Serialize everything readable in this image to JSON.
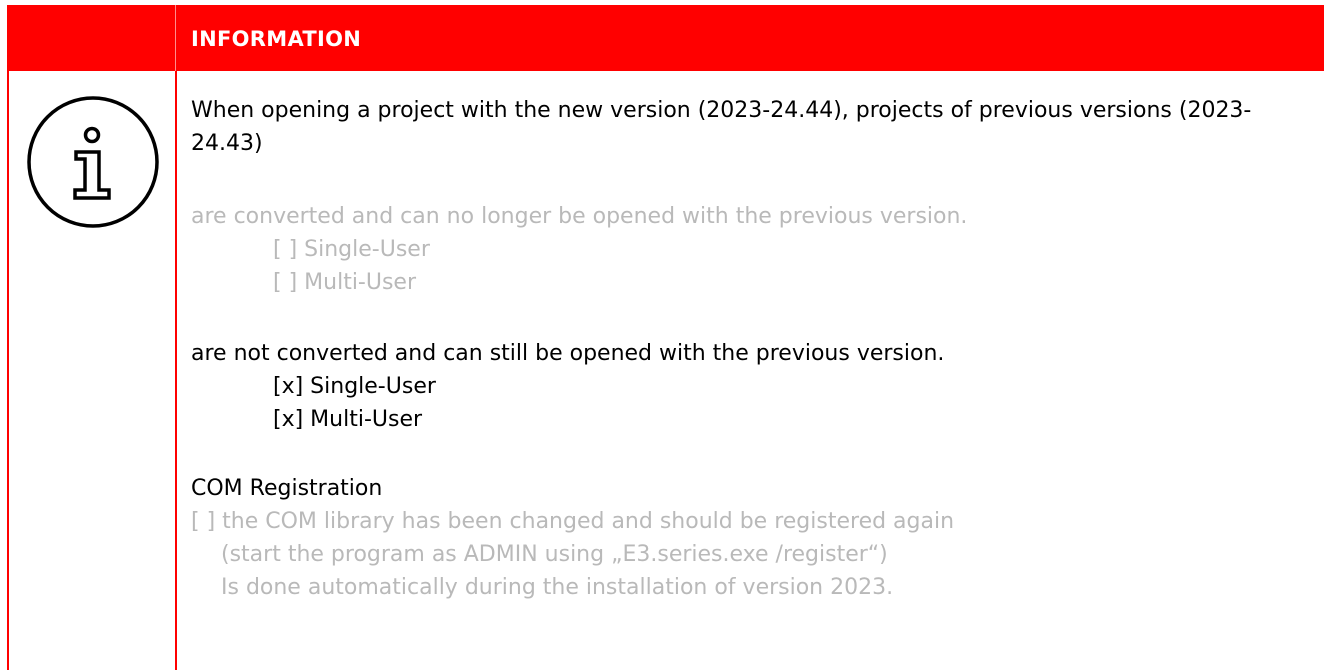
{
  "header": {
    "title": "INFORMATION"
  },
  "icon": {
    "name": "info-icon"
  },
  "content": {
    "intro": "When opening a project with the new version (2023-24.44), projects of previous versions (2023-24.43)",
    "converted": {
      "text": "are converted and can no longer be opened with the previous version.",
      "options": [
        "[ ] Single-User",
        "[ ] Multi-User"
      ]
    },
    "not_converted": {
      "text": "are not converted and can still be opened with the previous version.",
      "options": [
        "[x] Single-User",
        "[x] Multi-User"
      ]
    },
    "com": {
      "title": "COM Registration",
      "line1": "[ ] the COM library has been changed and should be registered again",
      "line2": "(start the program as ADMIN using „E3.series.exe /register“)",
      "line3": "Is done automatically during the installation of version 2023."
    }
  },
  "colors": {
    "accent": "#ff0000",
    "muted_text": "#b9b9b9",
    "text": "#000000"
  }
}
